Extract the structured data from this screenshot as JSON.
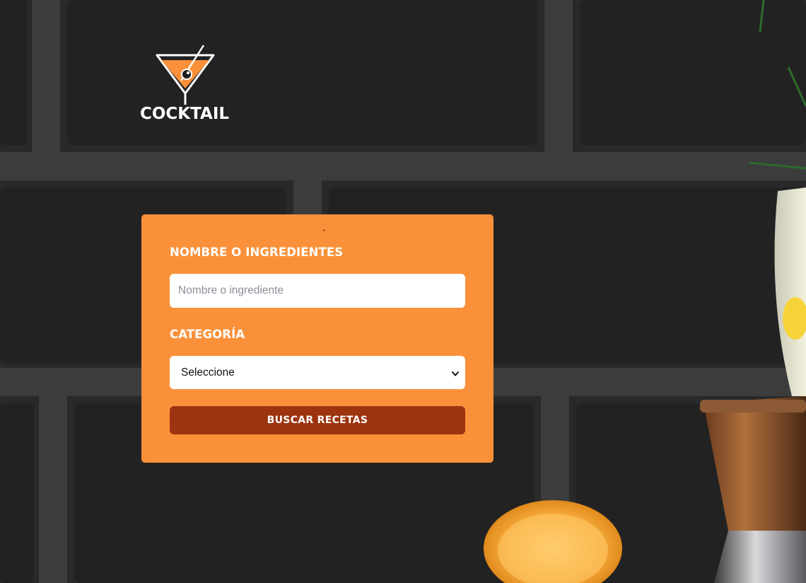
{
  "brand": {
    "name": "COCKTAIL",
    "logo_icon": "cocktail-glass-icon",
    "accent_color": "#fa913a"
  },
  "search_form": {
    "name_label": "NOMBRE O INGREDIENTES",
    "name_placeholder": "Nombre o ingrediente",
    "name_value": "",
    "category_label": "CATEGORÍA",
    "category_selected": "Seleccione",
    "submit_label": "BUSCAR RECETAS",
    "submit_color": "#9c3410"
  }
}
